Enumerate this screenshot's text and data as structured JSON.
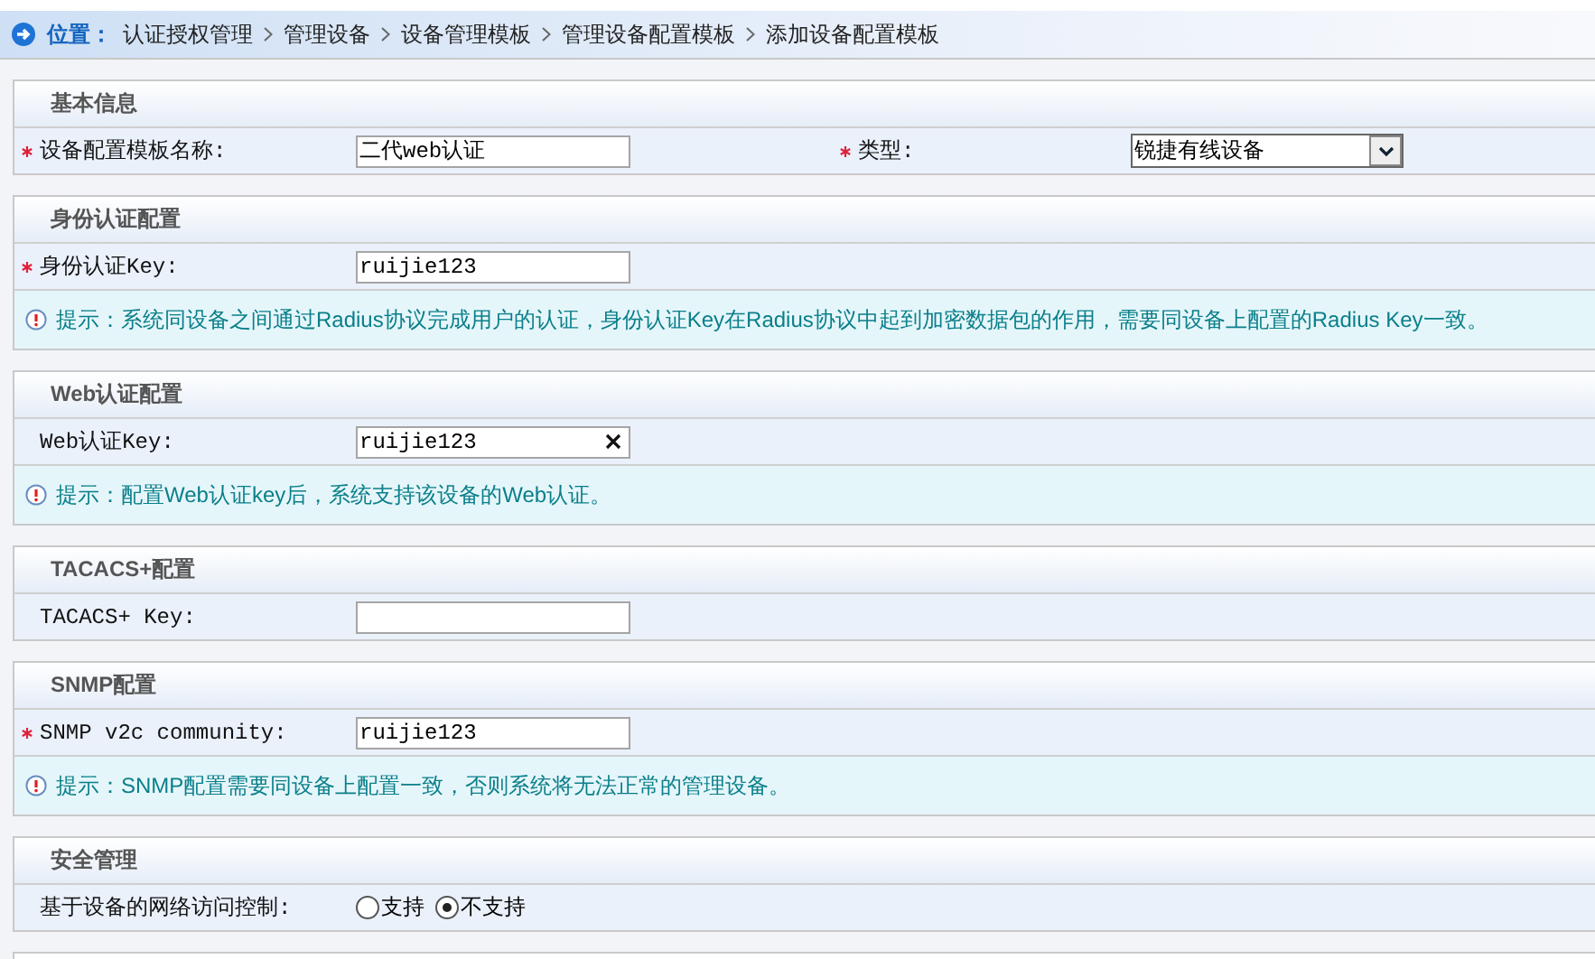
{
  "breadcrumb": {
    "label": "位置：",
    "items": [
      "认证授权管理",
      "管理设备",
      "设备管理模板",
      "管理设备配置模板",
      "添加设备配置模板"
    ]
  },
  "sections": [
    {
      "title": "基本信息",
      "rows": [
        [
          {
            "kind": "text",
            "label": "设备配置模板名称:",
            "required": true,
            "value": "二代web认证"
          },
          {
            "kind": "select",
            "label": "类型:",
            "required": true,
            "value": "锐捷有线设备"
          }
        ]
      ]
    },
    {
      "title": "身份认证配置",
      "rows": [
        [
          {
            "kind": "text",
            "label": "身份认证Key:",
            "required": true,
            "value": "ruijie123"
          }
        ]
      ],
      "hint": "提示：系统同设备之间通过Radius协议完成用户的认证，身份认证Key在Radius协议中起到加密数据包的作用，需要同设备上配置的Radius Key一致。"
    },
    {
      "title": "Web认证配置",
      "rows": [
        [
          {
            "kind": "text",
            "label": "Web认证Key:",
            "required": false,
            "value": "ruijie123",
            "clearable": true
          }
        ]
      ],
      "hint": "提示：配置Web认证key后，系统支持该设备的Web认证。"
    },
    {
      "title": "TACACS+配置",
      "rows": [
        [
          {
            "kind": "text",
            "label": "TACACS+ Key:",
            "required": false
          }
        ]
      ]
    },
    {
      "title": "SNMP配置",
      "rows": [
        [
          {
            "kind": "text",
            "label": "SNMP v2c community:",
            "required": true,
            "value": "ruijie123"
          }
        ]
      ],
      "hint": "提示：SNMP配置需要同设备上配置一致，否则系统将无法正常的管理设备。"
    },
    {
      "title": "安全管理",
      "rows": [
        [
          {
            "kind": "radio",
            "label": "基于设备的网络访问控制:",
            "required": false,
            "options": [
              {
                "label": "支持",
                "selected": false
              },
              {
                "label": "不支持",
                "selected": true
              }
            ]
          }
        ]
      ]
    }
  ]
}
